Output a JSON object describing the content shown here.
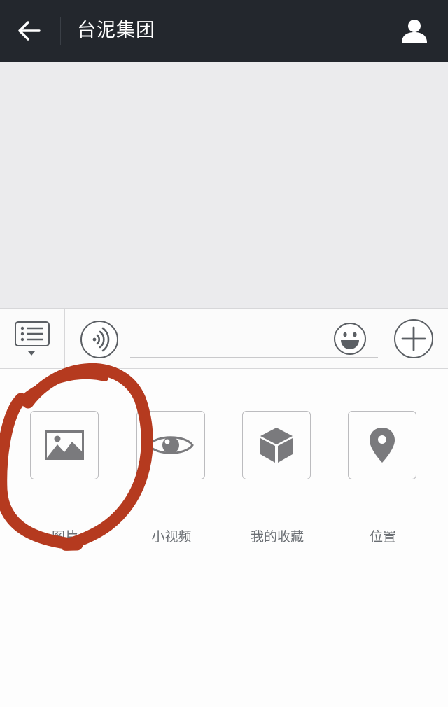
{
  "header": {
    "title": "台泥集团",
    "back_icon": "arrow-left-icon",
    "profile_icon": "person-icon",
    "background": "#23272d"
  },
  "chat": {
    "background": "#ebebed"
  },
  "input_bar": {
    "menu_icon": "list-icon",
    "voice_icon": "voice-icon",
    "text_value": "",
    "emoji_icon": "smiley-icon",
    "plus_icon": "plus-icon"
  },
  "panel": {
    "tools": [
      {
        "label": "图片",
        "icon": "image-icon"
      },
      {
        "label": "小视频",
        "icon": "eye-icon"
      },
      {
        "label": "我的收藏",
        "icon": "cube-icon"
      },
      {
        "label": "位置",
        "icon": "location-pin-icon"
      }
    ]
  },
  "annotation": {
    "shape": "hand-drawn circle",
    "color": "#b53a1f",
    "target": "图片"
  }
}
